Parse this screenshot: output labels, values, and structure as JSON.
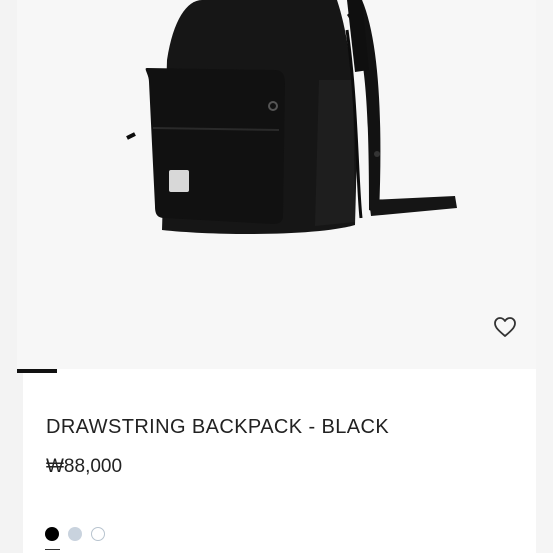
{
  "product": {
    "title": "DRAWSTRING BACKPACK - BLACK",
    "price": "₩88,000",
    "wishlist_icon": "heart-outline-icon",
    "swatches": [
      {
        "name": "black",
        "color": "#000000",
        "selected": true
      },
      {
        "name": "light-blue-gray",
        "color": "#c9d3de",
        "selected": false
      },
      {
        "name": "white",
        "color": "#ffffff",
        "selected": false
      }
    ]
  },
  "colors": {
    "image_background": "#f7f7f7",
    "backpack": "#161616",
    "text": "#222222"
  }
}
